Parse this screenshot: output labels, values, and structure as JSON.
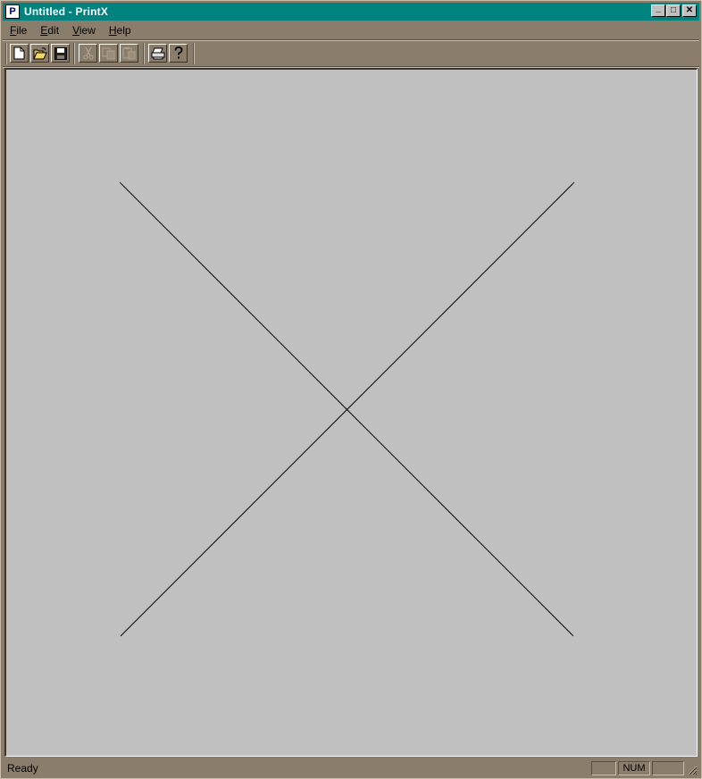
{
  "window": {
    "title": "Untitled - PrintX",
    "app_icon_glyph": "P",
    "title_color": "#00827f",
    "controls": {
      "minimize": "_",
      "maximize": "□",
      "close": "✕"
    }
  },
  "menu": {
    "items": [
      {
        "label": "File",
        "accel": "F",
        "rest": "ile"
      },
      {
        "label": "Edit",
        "accel": "E",
        "rest": "dit"
      },
      {
        "label": "View",
        "accel": "V",
        "rest": "iew"
      },
      {
        "label": "Help",
        "accel": "H",
        "rest": "elp"
      }
    ]
  },
  "toolbar": {
    "buttons": [
      {
        "name": "new",
        "icon": "new-document-icon",
        "enabled": true
      },
      {
        "name": "open",
        "icon": "open-folder-icon",
        "enabled": true
      },
      {
        "name": "save",
        "icon": "save-disk-icon",
        "enabled": true
      },
      {
        "name": "cut",
        "icon": "scissors-icon",
        "enabled": false
      },
      {
        "name": "copy",
        "icon": "copy-icon",
        "enabled": false
      },
      {
        "name": "paste",
        "icon": "paste-icon",
        "enabled": false
      },
      {
        "name": "print",
        "icon": "printer-icon",
        "enabled": true
      },
      {
        "name": "help",
        "icon": "help-question-icon",
        "enabled": true
      }
    ]
  },
  "canvas": {
    "background": "#c0c0c0",
    "drawing": "X",
    "line_color": "#000000"
  },
  "status": {
    "text": "Ready",
    "panes": [
      "",
      "NUM",
      ""
    ]
  }
}
